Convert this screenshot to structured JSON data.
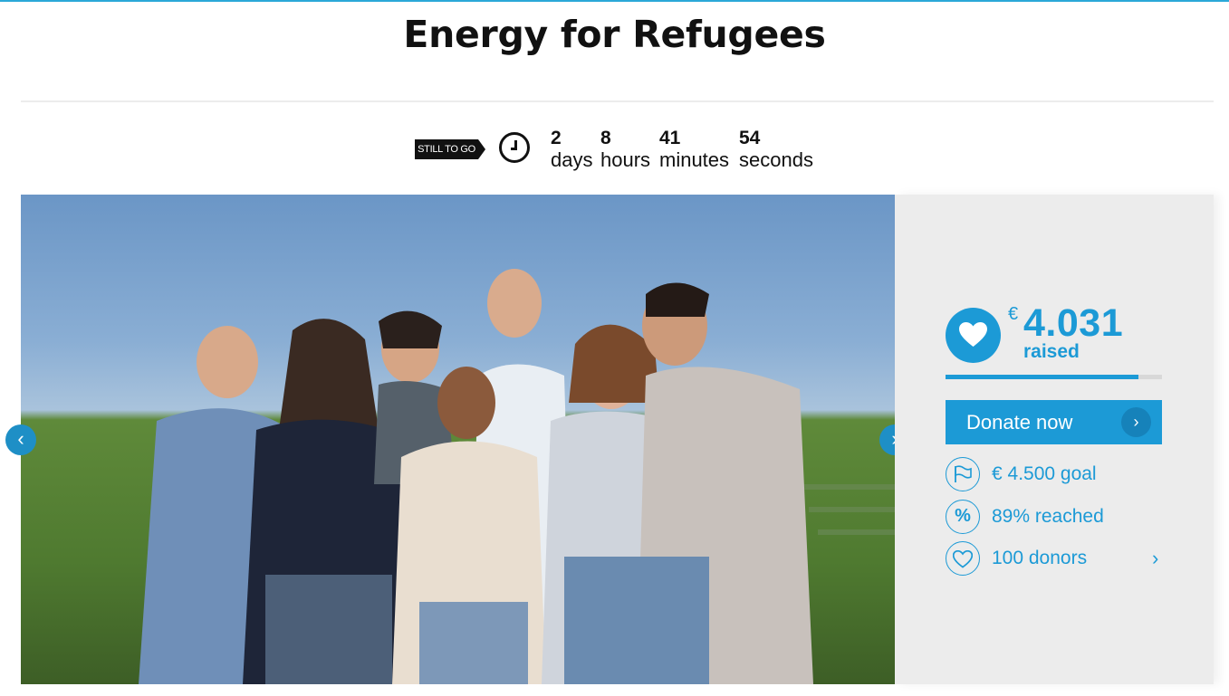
{
  "page": {
    "title": "Energy for Refugees"
  },
  "countdown": {
    "tag": "STILL TO GO",
    "days": {
      "value": "2",
      "label": "days"
    },
    "hours": {
      "value": "8",
      "label": "hours"
    },
    "minutes": {
      "value": "41",
      "label": "minutes"
    },
    "seconds": {
      "value": "54",
      "label": "seconds"
    }
  },
  "carousel": {
    "prev_icon": "chevron-left-icon",
    "next_icon": "chevron-right-icon"
  },
  "campaign": {
    "currency": "€",
    "raised_amount": "4.031",
    "raised_label": "raised",
    "progress_fraction": 0.89,
    "donate_label": "Donate now",
    "goal_text": "€ 4.500 goal",
    "reached_text": "89% reached",
    "donors_text": "100 donors"
  },
  "colors": {
    "accent": "#1c9ad6",
    "panel": "#ececec",
    "dark": "#111111"
  }
}
